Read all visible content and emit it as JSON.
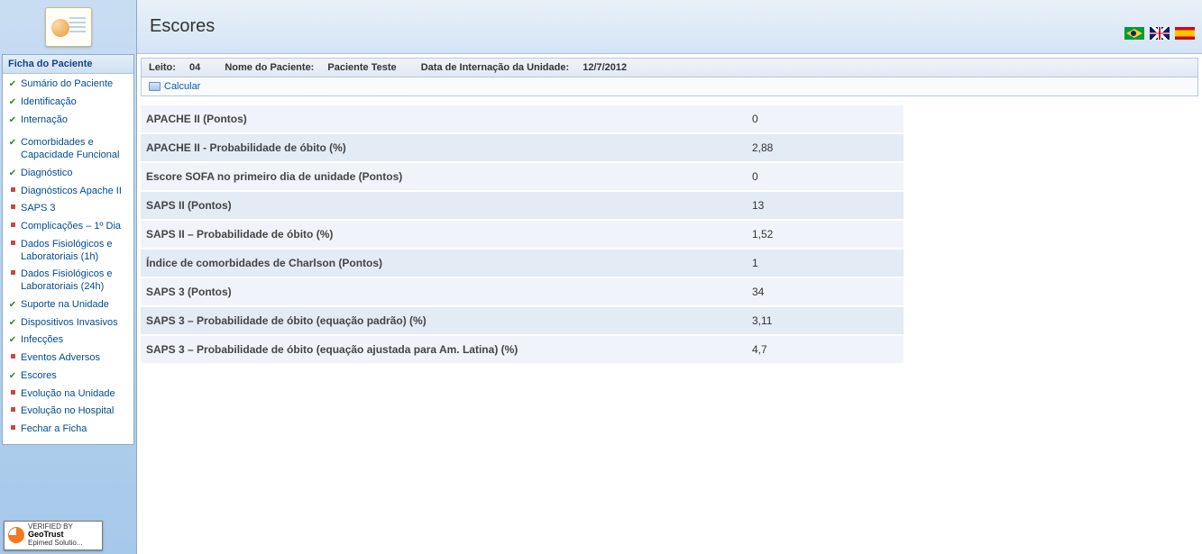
{
  "page_title": "Escores",
  "sidebar": {
    "header": "Ficha do Paciente",
    "items": [
      {
        "label": "Sumário do Paciente",
        "bullet": "check"
      },
      {
        "label": "Identificação",
        "bullet": "check"
      },
      {
        "label": "Internação",
        "bullet": "check"
      },
      {
        "label": "Comorbidades e Capacidade Funcional",
        "bullet": "check",
        "sep_before": true
      },
      {
        "label": "Diagnóstico",
        "bullet": "check"
      },
      {
        "label": "Diagnósticos Apache II",
        "bullet": "square"
      },
      {
        "label": "SAPS 3",
        "bullet": "square"
      },
      {
        "label": "Complicações – 1º Dia",
        "bullet": "square"
      },
      {
        "label": "Dados Fisiológicos e Laboratoriais (1h)",
        "bullet": "square"
      },
      {
        "label": "Dados Fisiológicos e Laboratoriais (24h)",
        "bullet": "square"
      },
      {
        "label": "Suporte na Unidade",
        "bullet": "check"
      },
      {
        "label": "Dispositivos Invasivos",
        "bullet": "check"
      },
      {
        "label": "Infecções",
        "bullet": "check"
      },
      {
        "label": "Eventos Adversos",
        "bullet": "square"
      },
      {
        "label": "Escores",
        "bullet": "check"
      },
      {
        "label": "Evolução na Unidade",
        "bullet": "square"
      },
      {
        "label": "Evolução no Hospital",
        "bullet": "square"
      },
      {
        "label": "Fechar a Ficha",
        "bullet": "square"
      }
    ]
  },
  "patient_bar": {
    "bed_label": "Leito:",
    "bed_value": "04",
    "name_label": "Nome do Paciente:",
    "name_value": "Paciente Teste",
    "admit_label": "Data de Internação da Unidade:",
    "admit_value": "12/7/2012"
  },
  "actions": {
    "calculate": "Calcular"
  },
  "scores": [
    {
      "label": "APACHE II (Pontos)",
      "value": "0"
    },
    {
      "label": "APACHE II - Probabilidade de óbito (%)",
      "value": "2,88"
    },
    {
      "label": "Escore SOFA no primeiro dia de unidade (Pontos)",
      "value": "0"
    },
    {
      "label": "SAPS II (Pontos)",
      "value": "13"
    },
    {
      "label": "SAPS II – Probabilidade de óbito (%)",
      "value": "1,52"
    },
    {
      "label": "Índice de comorbidades de Charlson (Pontos)",
      "value": "1"
    },
    {
      "label": "SAPS 3 (Pontos)",
      "value": "34"
    },
    {
      "label": "SAPS 3 – Probabilidade de óbito (equação padrão) (%)",
      "value": "3,11"
    },
    {
      "label": "SAPS 3 – Probabilidade de óbito (equação ajustada para Am. Latina) (%)",
      "value": "4,7"
    }
  ],
  "trustmark": {
    "verified": "VERIFIED BY",
    "brand": "GeoTrust",
    "sub": "Epimed Solutio..."
  }
}
